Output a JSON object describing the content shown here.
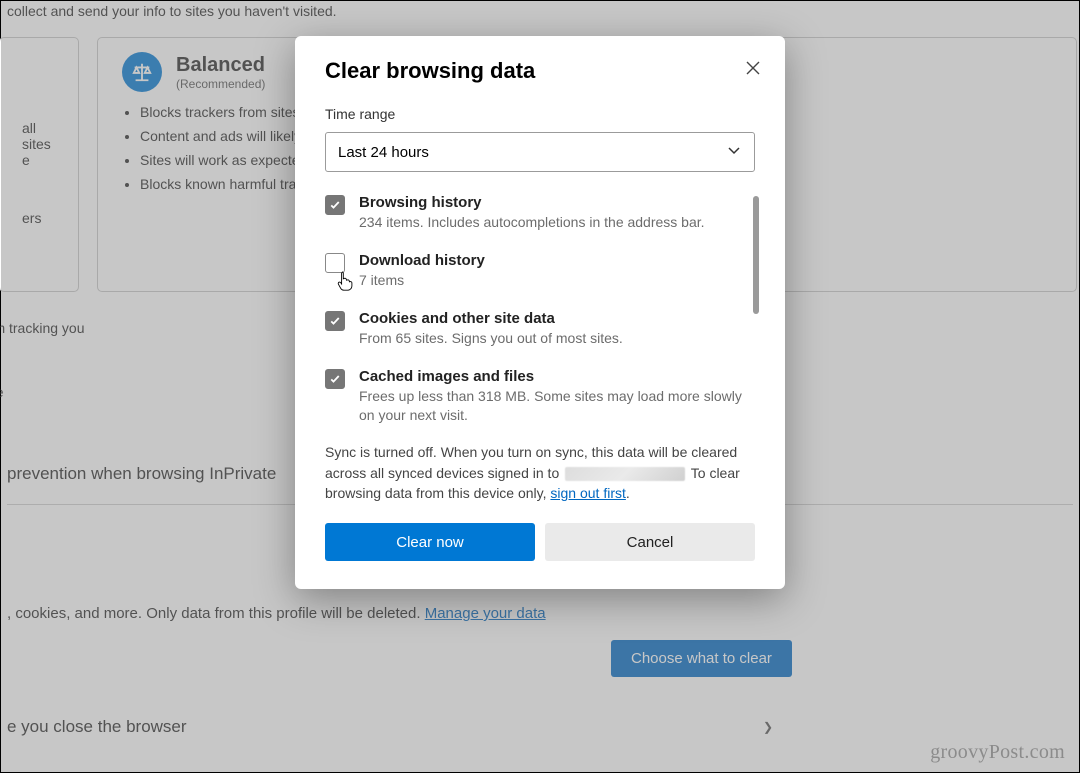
{
  "background": {
    "intro_line": "collect and send your info to sites you haven't visited.",
    "basic_card_fragment_1": "all sites",
    "basic_card_fragment_2": "e",
    "basic_card_fragment_3": "ers",
    "balanced": {
      "title": "Balanced",
      "recommended": "(Recommended)",
      "bullets": [
        "Blocks trackers from sites you haven't visited",
        "Content and ads will likely be less personalized",
        "Sites will work as expected",
        "Blocks known harmful trackers"
      ]
    },
    "tracking_line": "rom tracking you",
    "see_line": "ose",
    "inprivate_line": "prevention when browsing InPrivate",
    "clear_line_prefix": ", cookies, and more. Only data from this profile will be deleted. ",
    "clear_link": "Manage your data",
    "choose_button": "Choose what to clear",
    "close_browser_line": "e you close the browser"
  },
  "dialog": {
    "title": "Clear browsing data",
    "time_range_label": "Time range",
    "time_range_value": "Last 24 hours",
    "items": [
      {
        "checked": true,
        "title": "Browsing history",
        "sub": "234 items. Includes autocompletions in the address bar."
      },
      {
        "checked": false,
        "title": "Download history",
        "sub": "7 items"
      },
      {
        "checked": true,
        "title": "Cookies and other site data",
        "sub": "From 65 sites. Signs you out of most sites."
      },
      {
        "checked": true,
        "title": "Cached images and files",
        "sub": "Frees up less than 318 MB. Some sites may load more slowly on your next visit."
      }
    ],
    "sync_before": "Sync is turned off. When you turn on sync, this data will be cleared across all synced devices signed in to ",
    "sync_after": " To clear browsing data from this device only, ",
    "sync_link": "sign out first",
    "clear_now": "Clear now",
    "cancel": "Cancel"
  },
  "watermark": "groovyPost.com"
}
